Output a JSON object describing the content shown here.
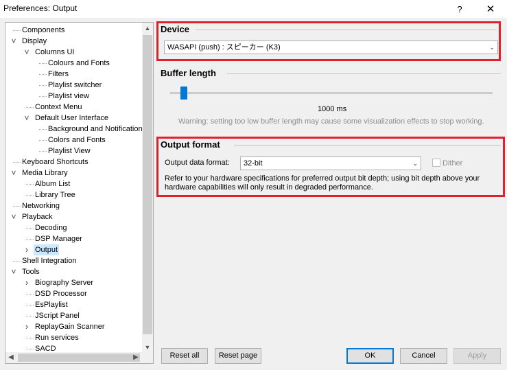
{
  "window": {
    "title": "Preferences: Output",
    "help_glyph": "?",
    "close_glyph": "✕"
  },
  "tree": {
    "items": [
      {
        "label": "Components",
        "toggle": ""
      },
      {
        "label": "Display",
        "toggle": "v"
      },
      {
        "label": "Columns UI",
        "toggle": "v"
      },
      {
        "label": "Colours and Fonts",
        "toggle": ""
      },
      {
        "label": "Filters",
        "toggle": ""
      },
      {
        "label": "Playlist switcher",
        "toggle": ""
      },
      {
        "label": "Playlist view",
        "toggle": ""
      },
      {
        "label": "Context Menu",
        "toggle": ""
      },
      {
        "label": "Default User Interface",
        "toggle": "v"
      },
      {
        "label": "Background and Notifications",
        "toggle": ""
      },
      {
        "label": "Colors and Fonts",
        "toggle": ""
      },
      {
        "label": "Playlist View",
        "toggle": ""
      },
      {
        "label": "Keyboard Shortcuts",
        "toggle": ""
      },
      {
        "label": "Media Library",
        "toggle": "v"
      },
      {
        "label": "Album List",
        "toggle": ""
      },
      {
        "label": "Library Tree",
        "toggle": ""
      },
      {
        "label": "Networking",
        "toggle": ""
      },
      {
        "label": "Playback",
        "toggle": "v"
      },
      {
        "label": "Decoding",
        "toggle": ""
      },
      {
        "label": "DSP Manager",
        "toggle": ""
      },
      {
        "label": "Output",
        "toggle": ">",
        "selected": true
      },
      {
        "label": "Shell Integration",
        "toggle": ""
      },
      {
        "label": "Tools",
        "toggle": "v"
      },
      {
        "label": "Biography Server",
        "toggle": ">"
      },
      {
        "label": "DSD Processor",
        "toggle": ""
      },
      {
        "label": "EsPlaylist",
        "toggle": ""
      },
      {
        "label": "JScript Panel",
        "toggle": ""
      },
      {
        "label": "ReplayGain Scanner",
        "toggle": ">"
      },
      {
        "label": "Run services",
        "toggle": ""
      },
      {
        "label": "SACD",
        "toggle": ""
      }
    ]
  },
  "device": {
    "header": "Device",
    "selected": "WASAPI (push) : スピーカー (K3)"
  },
  "buffer": {
    "header": "Buffer length",
    "value_label": "1000 ms",
    "level_fraction": 0.03,
    "warning": "Warning: setting too low buffer length may cause some visualization effects to stop working."
  },
  "output_format": {
    "header": "Output format",
    "label": "Output data format:",
    "selected": "32-bit",
    "dither_label": "Dither",
    "dither_checked": false,
    "dither_enabled": false,
    "note_line1": "Refer to your hardware specifications for preferred output bit depth; using bit depth above your",
    "note_line2": "hardware capabilities will only result in degraded performance."
  },
  "buttons": {
    "reset_all": "Reset all",
    "reset_page": "Reset page",
    "ok": "OK",
    "cancel": "Cancel",
    "apply": "Apply"
  },
  "colors": {
    "highlight_box": "#e0202a",
    "selection": "#cce8ff",
    "slider_accent": "#0078d7"
  }
}
